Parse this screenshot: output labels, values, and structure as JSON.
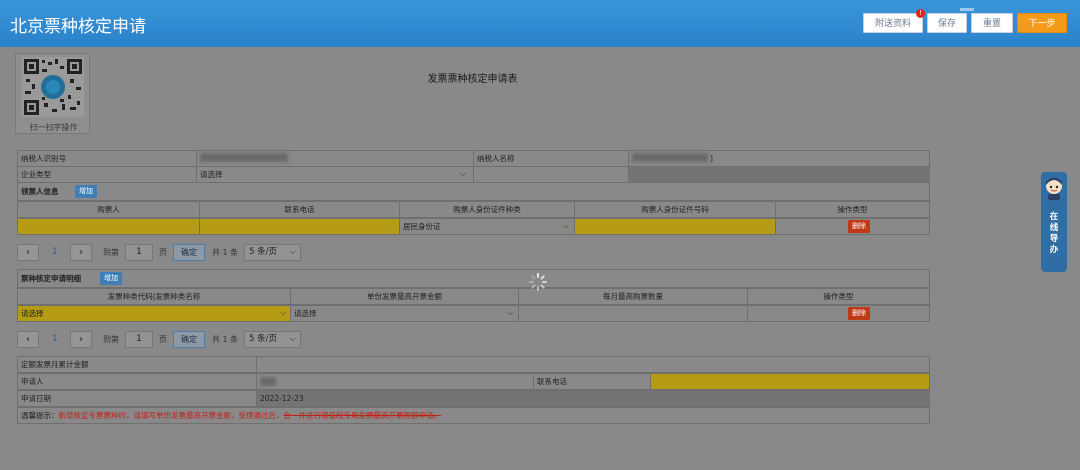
{
  "header": {
    "title": "北京票种核定申请",
    "buttons": {
      "attach": "附送资料",
      "save": "保存",
      "reset": "重置",
      "next": "下一步"
    },
    "attach_badge": "!",
    "colors": {
      "header_bg": "#2a82c9",
      "next_bg": "#f59a1b"
    }
  },
  "qr": {
    "label": "扫一扫字操作"
  },
  "form": {
    "title": "发票票种核定申请表",
    "taxpayer_id_label": "纳税人识别号",
    "taxpayer_name_label": "纳税人名称",
    "taxpayer_name_suffix": "]",
    "enterprise_type_label": "企业类型",
    "enterprise_type_value": "请选择"
  },
  "buyer_section": {
    "title": "领票人信息",
    "add_label": "增加",
    "columns": [
      "购票人",
      "联系电话",
      "购票人身份证件种类",
      "购票人身份证件号码",
      "操作类型"
    ],
    "row": {
      "id_type": "居民身份证",
      "delete_label": "删除"
    }
  },
  "pager1": {
    "page": "1",
    "goto_label": "到第",
    "goto_value": "1",
    "page_unit": "页",
    "ok_label": "确定",
    "total": "共 1 条",
    "page_size": "5 条/页"
  },
  "detail_section": {
    "title": "票种核定申请明细",
    "add_label": "增加",
    "columns": [
      "发票种类代码|发票种类名称",
      "单份发票最高开票金额",
      "每月最高购票数量",
      "操作类型"
    ],
    "row": {
      "type_value": "请选择",
      "amount_value": "请选择",
      "delete_label": "删除"
    }
  },
  "pager2": {
    "page": "1",
    "goto_label": "到第",
    "goto_value": "1",
    "page_unit": "页",
    "ok_label": "确定",
    "total": "共 1 条",
    "page_size": "5 条/页"
  },
  "summary": {
    "monthly_total_label": "定额发票月累计金额",
    "applicant_label": "申请人",
    "phone_label": "联系电话",
    "date_label": "申请日期",
    "date_value": "2022-12-23",
    "notice_prefix": "温馨提示：",
    "notice_text": "新增核定专票票种时，请填写单份发票最高开票金额，受理通过后，",
    "notice_strike": "会一并进行增值税专用发票最高开票限额申请。"
  },
  "side_guide": {
    "text": "在线导办"
  }
}
